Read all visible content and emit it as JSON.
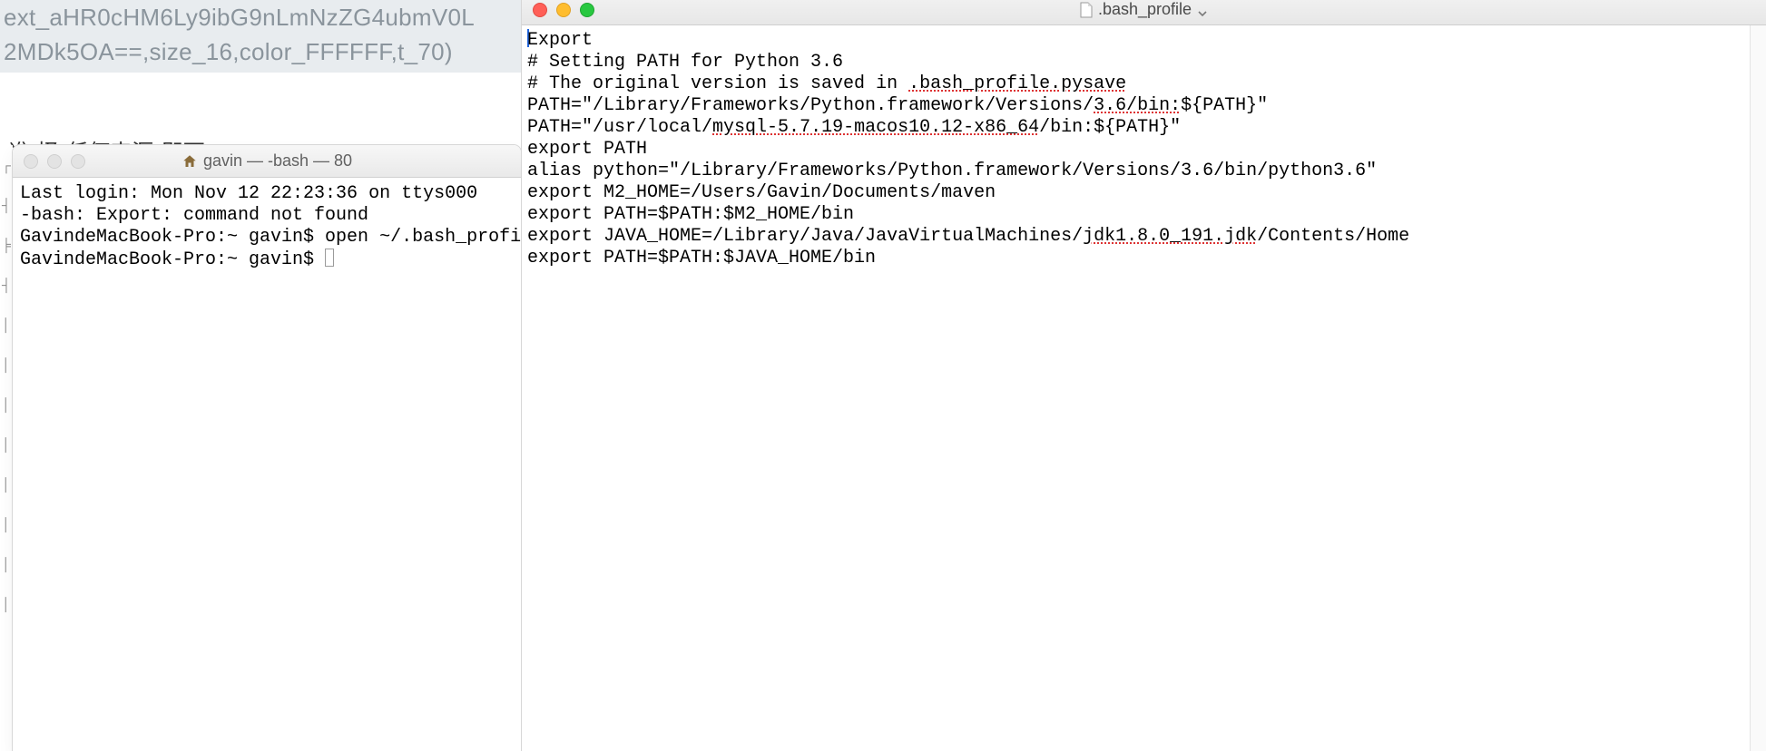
{
  "background": {
    "url_fragment_line1": "ext_aHR0cHM6Ly9ibG9nLmNzZG4ubmV0L",
    "url_fragment_line2": "2MDk5OA==,size_16,color_FFFFFF,t_70)",
    "partial_chinese": "准 择\"任何来源\"即可"
  },
  "terminal": {
    "title_prefix": "gavin — -bash — 80",
    "icon": "home-icon",
    "lines": [
      "Last login: Mon Nov 12 22:23:36 on ttys000",
      "-bash: Export: command not found",
      "GavindeMacBook-Pro:~ gavin$ open ~/.bash_profile",
      "GavindeMacBook-Pro:~ gavin$ "
    ]
  },
  "textedit": {
    "title": ".bash_profile",
    "dropdown_icon": "chevron-down-icon",
    "doc_icon": "document-icon",
    "lines": [
      {
        "plain": "Export",
        "caret_before": true
      },
      {
        "plain": "# Setting PATH for Python 3.6"
      },
      {
        "segments": [
          {
            "t": "# The original version is saved in "
          },
          {
            "t": ".bash_profile.pysave",
            "bad": true
          }
        ]
      },
      {
        "segments": [
          {
            "t": "PATH=\"/Library/Frameworks/Python.framework/Versions/"
          },
          {
            "t": "3.6/bin:",
            "bad": true
          },
          {
            "t": "${PATH}\""
          }
        ]
      },
      {
        "segments": [
          {
            "t": "PATH=\"/usr/local/"
          },
          {
            "t": "mysql-5.7.19-macos10.12-x86_64",
            "bad": true
          },
          {
            "t": "/bin:${PATH}\""
          }
        ]
      },
      {
        "plain": "export PATH"
      },
      {
        "plain": "alias python=\"/Library/Frameworks/Python.framework/Versions/3.6/bin/python3.6\""
      },
      {
        "plain": "export M2_HOME=/Users/Gavin/Documents/maven"
      },
      {
        "plain": "export PATH=$PATH:$M2_HOME/bin"
      },
      {
        "segments": [
          {
            "t": "export JAVA_HOME=/Library/Java/JavaVirtualMachines/"
          },
          {
            "t": "jdk1.8.0_191.jdk",
            "bad": true
          },
          {
            "t": "/Contents/Home"
          }
        ]
      },
      {
        "plain": "export PATH=$PATH:$JAVA_HOME/bin"
      }
    ]
  }
}
